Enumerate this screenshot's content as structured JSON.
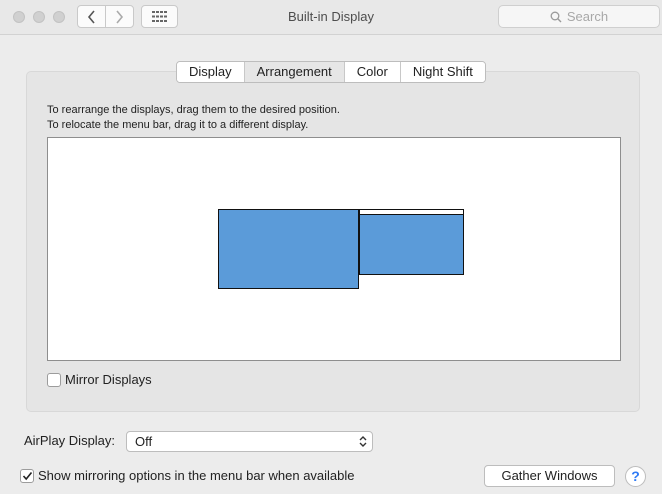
{
  "window": {
    "title": "Built-in Display",
    "search_placeholder": "Search",
    "icons": {
      "back": "chevron-left-icon",
      "forward": "chevron-right-icon",
      "show_all": "grid-icon",
      "search": "search-icon"
    }
  },
  "tabs": [
    {
      "label": "Display",
      "selected": false
    },
    {
      "label": "Arrangement",
      "selected": true
    },
    {
      "label": "Color",
      "selected": false
    },
    {
      "label": "Night Shift",
      "selected": false
    }
  ],
  "arrangement": {
    "instruction_line1": "To rearrange the displays, drag them to the desired position.",
    "instruction_line2": "To relocate the menu bar, drag it to a different display.",
    "display_color": "#5b9bd9",
    "mirror_label": "Mirror Displays",
    "mirror_checked": false
  },
  "airplay": {
    "label": "AirPlay Display:",
    "value": "Off"
  },
  "footer": {
    "show_mirroring_label": "Show mirroring options in the menu bar when available",
    "show_mirroring_checked": true,
    "gather_label": "Gather Windows",
    "help_label": "?"
  }
}
